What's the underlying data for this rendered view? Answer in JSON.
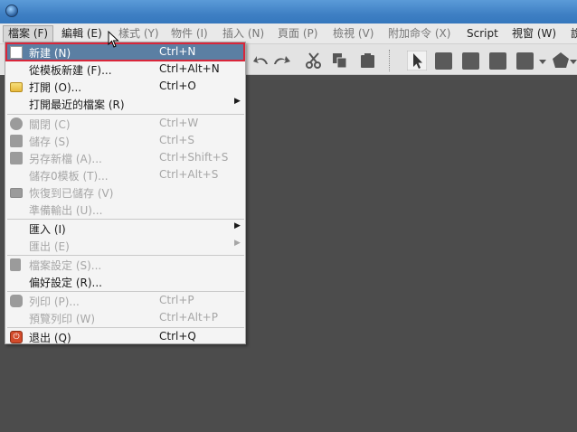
{
  "menubar": {
    "items": [
      {
        "label": "檔案 (F)",
        "state": "open"
      },
      {
        "label": "編輯 (E)",
        "state": "normal"
      },
      {
        "label": "樣式 (Y)",
        "state": "disabled"
      },
      {
        "label": "物件 (I)",
        "state": "disabled"
      },
      {
        "label": "插入 (N)",
        "state": "disabled"
      },
      {
        "label": "頁面 (P)",
        "state": "disabled"
      },
      {
        "label": "檢視 (V)",
        "state": "disabled"
      },
      {
        "label": "附加命令 (X)",
        "state": "disabled"
      },
      {
        "label": "Script",
        "state": "normal"
      },
      {
        "label": "視窗 (W)",
        "state": "normal"
      },
      {
        "label": "說",
        "state": "normal"
      }
    ]
  },
  "file_menu": {
    "items": [
      {
        "label": "新建 (N)",
        "shortcut": "Ctrl+N",
        "icon": "new-document-icon",
        "state": "highlighted"
      },
      {
        "label": "從模板新建 (F)...",
        "shortcut": "Ctrl+Alt+N",
        "icon": "",
        "state": "normal"
      },
      {
        "label": "打開 (O)...",
        "shortcut": "Ctrl+O",
        "icon": "open-folder-icon",
        "state": "normal"
      },
      {
        "label": "打開最近的檔案 (R)",
        "shortcut": "",
        "icon": "",
        "state": "normal",
        "submenu": true
      },
      {
        "label": "關閉 (C)",
        "shortcut": "Ctrl+W",
        "icon": "close-circle-icon",
        "state": "disabled"
      },
      {
        "label": "儲存 (S)",
        "shortcut": "Ctrl+S",
        "icon": "save-icon",
        "state": "disabled"
      },
      {
        "label": "另存新檔 (A)...",
        "shortcut": "Ctrl+Shift+S",
        "icon": "save-as-icon",
        "state": "disabled"
      },
      {
        "label": "儲存0模板 (T)...",
        "shortcut": "Ctrl+Alt+S",
        "icon": "",
        "state": "disabled"
      },
      {
        "label": "恢復到已儲存 (V)",
        "shortcut": "",
        "icon": "revert-icon",
        "state": "disabled"
      },
      {
        "label": "準備輸出 (U)...",
        "shortcut": "",
        "icon": "",
        "state": "disabled"
      },
      {
        "label": "匯入 (I)",
        "shortcut": "",
        "icon": "",
        "state": "normal",
        "submenu": true
      },
      {
        "label": "匯出 (E)",
        "shortcut": "",
        "icon": "",
        "state": "disabled",
        "submenu": true
      },
      {
        "label": "檔案設定 (S)...",
        "shortcut": "",
        "icon": "document-settings-icon",
        "state": "disabled"
      },
      {
        "label": "偏好設定 (R)...",
        "shortcut": "",
        "icon": "",
        "state": "normal"
      },
      {
        "label": "列印 (P)...",
        "shortcut": "Ctrl+P",
        "icon": "print-icon",
        "state": "disabled"
      },
      {
        "label": "預覽列印 (W)",
        "shortcut": "Ctrl+Alt+P",
        "icon": "",
        "state": "disabled"
      },
      {
        "label": "退出 (Q)",
        "shortcut": "Ctrl+Q",
        "icon": "power-icon",
        "state": "normal"
      }
    ],
    "arrow": "▶"
  },
  "colors": {
    "titlebar": "#3f80c4",
    "highlight": "#5b7fa3",
    "highlight_outline": "#d9263a",
    "workarea": "#4c4c4c"
  },
  "icons": {
    "toolbar": [
      "undo-icon",
      "redo-icon",
      "cut-icon",
      "copy-icon",
      "paste-icon",
      "select-pointer-icon",
      "frame-icon",
      "image-frame-icon",
      "table-icon",
      "shape-icon",
      "polygon-icon"
    ],
    "power_glyph": "⏻"
  }
}
